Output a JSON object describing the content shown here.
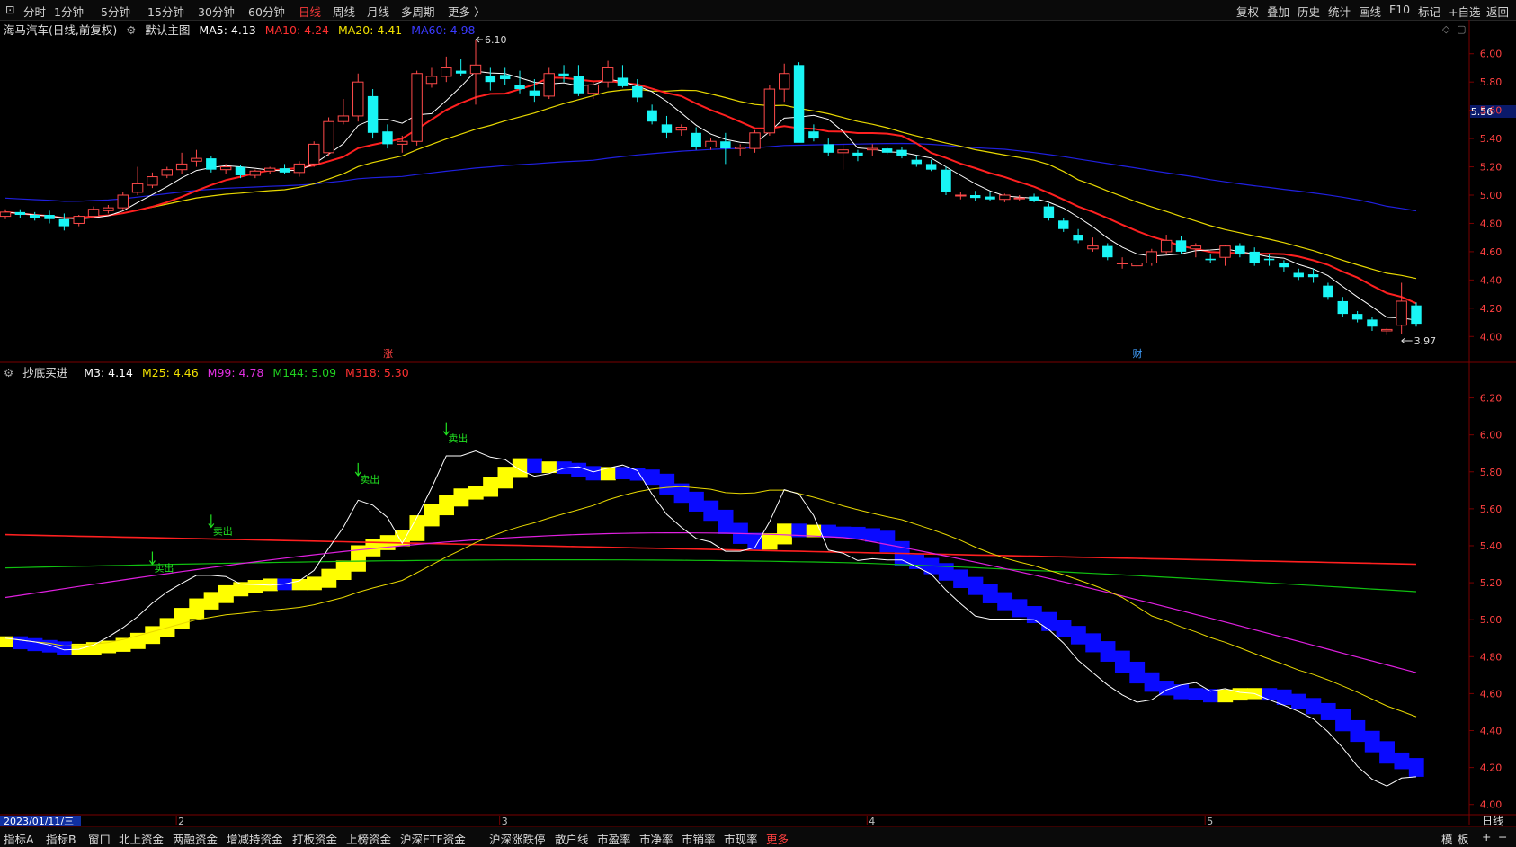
{
  "toolbar": {
    "periods": [
      "分时",
      "1分钟",
      "5分钟",
      "15分钟",
      "30分钟",
      "60分钟",
      "日线",
      "周线",
      "月线",
      "多周期",
      "更多 〉"
    ],
    "active_period": "日线",
    "right_items": [
      "复权",
      "叠加",
      "历史",
      "统计",
      "画线",
      "F10",
      "标记",
      "+自选",
      "返回"
    ]
  },
  "main_title": {
    "stock": "海马汽车(日线,前复权)",
    "template": "默认主图",
    "ma5": "MA5: 4.13",
    "ma10": "MA10: 4.24",
    "ma20": "MA20: 4.41",
    "ma60": "MA60: 4.98"
  },
  "indicator_title": {
    "name": "抄底买进",
    "m3": "M3: 4.14",
    "m25": "M25: 4.46",
    "m99": "M99: 4.78",
    "m144": "M144: 5.09",
    "m318": "M318: 5.30"
  },
  "price_axis_top": [
    "6.00",
    "5.80",
    "5.60",
    "5.40",
    "5.20",
    "5.00",
    "4.80",
    "4.60",
    "4.40",
    "4.20",
    "4.00"
  ],
  "price_axis_bottom": [
    "6.20",
    "6.00",
    "5.80",
    "5.60",
    "5.40",
    "5.20",
    "5.00",
    "4.80",
    "4.60",
    "4.40",
    "4.20",
    "4.00"
  ],
  "current_price_label": "5.56",
  "high_marker": "6.10",
  "low_marker": "3.97",
  "event_markers": [
    "涨",
    "财"
  ],
  "signal_label": "卖出",
  "date_axis": {
    "current_date": "2023/01/11/三",
    "months": [
      "2",
      "3",
      "4",
      "5"
    ],
    "period_label": "日线"
  },
  "bottom_tabs": [
    "指标A",
    "指标B",
    "窗口",
    "北上资金",
    "两融资金",
    "增减持资金",
    "打板资金",
    "上榜资金",
    "沪深ETF资金",
    "沪深涨跌停",
    "散户线",
    "市盈率",
    "市净率",
    "市销率",
    "市现率",
    "更多"
  ],
  "bottom_right": [
    "模",
    "板",
    "+",
    "−"
  ],
  "colors": {
    "up": "#ff4a4a",
    "down": "#19f5f5",
    "ma5": "#ffffff",
    "ma10": "#ff2020",
    "ma20": "#e8d800",
    "ma60": "#2020e0",
    "m99": "#e020e0",
    "m144": "#10c010",
    "m318": "#ff2020",
    "band_up": "#ffff00",
    "band_down": "#0a0aff",
    "signal": "#20e020"
  },
  "chart_data": [
    {
      "type": "candlestick",
      "title": "海马汽车(日线,前复权)",
      "ylim": [
        3.9,
        6.1
      ],
      "series": [
        {
          "name": "MA5",
          "last": 4.13
        },
        {
          "name": "MA10",
          "last": 4.24
        },
        {
          "name": "MA20",
          "last": 4.41
        },
        {
          "name": "MA60",
          "last": 4.98
        }
      ],
      "ohlc": [
        [
          4.85,
          4.9,
          4.83,
          4.88
        ],
        [
          4.88,
          4.9,
          4.84,
          4.86
        ],
        [
          4.86,
          4.88,
          4.82,
          4.84
        ],
        [
          4.86,
          4.89,
          4.8,
          4.83
        ],
        [
          4.83,
          4.87,
          4.75,
          4.78
        ],
        [
          4.8,
          4.86,
          4.78,
          4.85
        ],
        [
          4.85,
          4.92,
          4.84,
          4.9
        ],
        [
          4.89,
          4.93,
          4.87,
          4.91
        ],
        [
          4.91,
          5.02,
          4.9,
          5.0
        ],
        [
          5.02,
          5.2,
          5.0,
          5.08
        ],
        [
          5.07,
          5.16,
          5.05,
          5.13
        ],
        [
          5.14,
          5.2,
          5.12,
          5.18
        ],
        [
          5.18,
          5.3,
          5.15,
          5.22
        ],
        [
          5.24,
          5.32,
          5.2,
          5.26
        ],
        [
          5.26,
          5.28,
          5.16,
          5.18
        ],
        [
          5.18,
          5.22,
          5.15,
          5.2
        ],
        [
          5.2,
          5.21,
          5.12,
          5.14
        ],
        [
          5.14,
          5.18,
          5.12,
          5.17
        ],
        [
          5.17,
          5.2,
          5.15,
          5.19
        ],
        [
          5.19,
          5.22,
          5.15,
          5.16
        ],
        [
          5.16,
          5.24,
          5.13,
          5.22
        ],
        [
          5.22,
          5.38,
          5.2,
          5.36
        ],
        [
          5.3,
          5.55,
          5.28,
          5.52
        ],
        [
          5.52,
          5.68,
          5.5,
          5.56
        ],
        [
          5.56,
          5.86,
          5.52,
          5.8
        ],
        [
          5.7,
          5.75,
          5.4,
          5.44
        ],
        [
          5.45,
          5.5,
          5.33,
          5.36
        ],
        [
          5.36,
          5.42,
          5.3,
          5.38
        ],
        [
          5.38,
          5.88,
          5.35,
          5.86
        ],
        [
          5.79,
          5.9,
          5.76,
          5.84
        ],
        [
          5.84,
          5.98,
          5.8,
          5.9
        ],
        [
          5.88,
          5.96,
          5.84,
          5.86
        ],
        [
          5.86,
          6.1,
          5.64,
          5.92
        ],
        [
          5.84,
          5.9,
          5.74,
          5.8
        ],
        [
          5.85,
          5.9,
          5.78,
          5.82
        ],
        [
          5.78,
          5.88,
          5.72,
          5.75
        ],
        [
          5.74,
          5.82,
          5.66,
          5.7
        ],
        [
          5.7,
          5.9,
          5.68,
          5.86
        ],
        [
          5.86,
          5.92,
          5.8,
          5.84
        ],
        [
          5.84,
          5.92,
          5.7,
          5.72
        ],
        [
          5.72,
          5.8,
          5.68,
          5.78
        ],
        [
          5.8,
          5.95,
          5.76,
          5.9
        ],
        [
          5.83,
          5.92,
          5.76,
          5.77
        ],
        [
          5.77,
          5.82,
          5.66,
          5.69
        ],
        [
          5.6,
          5.64,
          5.5,
          5.52
        ],
        [
          5.5,
          5.56,
          5.4,
          5.44
        ],
        [
          5.46,
          5.5,
          5.42,
          5.48
        ],
        [
          5.44,
          5.48,
          5.32,
          5.34
        ],
        [
          5.34,
          5.4,
          5.32,
          5.38
        ],
        [
          5.38,
          5.44,
          5.22,
          5.33
        ],
        [
          5.33,
          5.36,
          5.28,
          5.34
        ],
        [
          5.33,
          5.46,
          5.3,
          5.44
        ],
        [
          5.44,
          5.78,
          5.42,
          5.75
        ],
        [
          5.75,
          5.93,
          5.66,
          5.86
        ],
        [
          5.92,
          5.94,
          5.44,
          5.37
        ],
        [
          5.45,
          5.5,
          5.38,
          5.4
        ],
        [
          5.36,
          5.4,
          5.28,
          5.3
        ],
        [
          5.3,
          5.36,
          5.18,
          5.32
        ],
        [
          5.3,
          5.32,
          5.24,
          5.28
        ],
        [
          5.32,
          5.36,
          5.28,
          5.33
        ],
        [
          5.33,
          5.34,
          5.29,
          5.3
        ],
        [
          5.32,
          5.34,
          5.26,
          5.28
        ],
        [
          5.25,
          5.28,
          5.2,
          5.22
        ],
        [
          5.22,
          5.25,
          5.17,
          5.18
        ],
        [
          5.18,
          5.2,
          5.0,
          5.02
        ],
        [
          5.0,
          5.02,
          4.97,
          5.0
        ],
        [
          5.0,
          5.03,
          4.96,
          4.98
        ],
        [
          4.99,
          5.02,
          4.96,
          4.97
        ],
        [
          4.97,
          5.01,
          4.95,
          5.0
        ],
        [
          4.98,
          5.0,
          4.96,
          4.98
        ],
        [
          4.99,
          5.01,
          4.95,
          4.96
        ],
        [
          4.92,
          4.94,
          4.82,
          4.84
        ],
        [
          4.82,
          4.84,
          4.74,
          4.76
        ],
        [
          4.72,
          4.76,
          4.66,
          4.68
        ],
        [
          4.62,
          4.7,
          4.6,
          4.64
        ],
        [
          4.64,
          4.66,
          4.54,
          4.56
        ],
        [
          4.52,
          4.56,
          4.48,
          4.52
        ],
        [
          4.5,
          4.54,
          4.48,
          4.52
        ],
        [
          4.52,
          4.62,
          4.5,
          4.6
        ],
        [
          4.6,
          4.72,
          4.58,
          4.68
        ],
        [
          4.68,
          4.71,
          4.58,
          4.6
        ],
        [
          4.62,
          4.66,
          4.56,
          4.64
        ],
        [
          4.55,
          4.58,
          4.52,
          4.54
        ],
        [
          4.56,
          4.65,
          4.5,
          4.64
        ],
        [
          4.64,
          4.66,
          4.56,
          4.58
        ],
        [
          4.6,
          4.63,
          4.5,
          4.52
        ],
        [
          4.55,
          4.58,
          4.5,
          4.54
        ],
        [
          4.52,
          4.54,
          4.46,
          4.49
        ],
        [
          4.45,
          4.48,
          4.4,
          4.42
        ],
        [
          4.44,
          4.48,
          4.38,
          4.42
        ],
        [
          4.36,
          4.38,
          4.26,
          4.28
        ],
        [
          4.25,
          4.28,
          4.14,
          4.16
        ],
        [
          4.16,
          4.18,
          4.1,
          4.12
        ],
        [
          4.12,
          4.14,
          4.04,
          4.07
        ],
        [
          4.04,
          4.06,
          4.01,
          4.05
        ],
        [
          4.08,
          4.38,
          4.02,
          4.25
        ],
        [
          4.22,
          4.24,
          4.07,
          4.09
        ]
      ]
    },
    {
      "type": "line",
      "title": "抄底买进",
      "ylim": [
        3.95,
        6.3
      ],
      "series": [
        {
          "name": "M3",
          "last": 4.14
        },
        {
          "name": "M25",
          "last": 4.46
        },
        {
          "name": "M99",
          "last": 4.78
        },
        {
          "name": "M144",
          "last": 5.09
        },
        {
          "name": "M318",
          "last": 5.3
        }
      ],
      "signals": [
        "卖出",
        "卖出",
        "卖出",
        "卖出"
      ]
    }
  ]
}
